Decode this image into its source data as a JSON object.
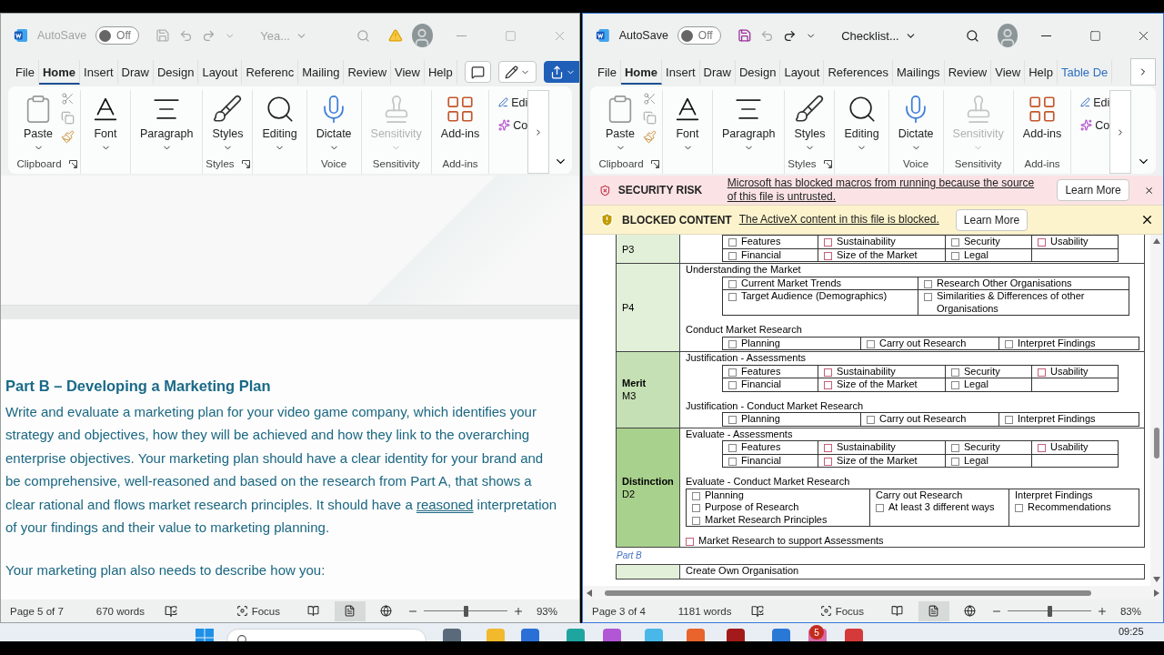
{
  "windows": [
    {
      "active": false,
      "title_bar": {
        "autosave_label": "AutoSave",
        "autosave": {
          "label": "Off",
          "on": false
        },
        "document_title": "Yea...",
        "warning": true
      },
      "tabs": [
        {
          "label": "File",
          "selected": false,
          "kind": "plain"
        },
        {
          "label": "Home",
          "selected": true,
          "kind": "plain"
        },
        {
          "label": "Insert",
          "selected": false,
          "kind": "plain"
        },
        {
          "label": "Draw",
          "selected": false,
          "kind": "plain"
        },
        {
          "label": "Design",
          "selected": false,
          "kind": "plain"
        },
        {
          "label": "Layout",
          "selected": false,
          "kind": "plain"
        },
        {
          "label": "Referenc",
          "selected": false,
          "kind": "plain"
        },
        {
          "label": "Mailing",
          "selected": false,
          "kind": "plain"
        },
        {
          "label": "Review",
          "selected": false,
          "kind": "plain"
        },
        {
          "label": "View",
          "selected": false,
          "kind": "plain"
        },
        {
          "label": "Help",
          "selected": false,
          "kind": "plain"
        }
      ],
      "tab_actions": [
        {
          "kind": "comment"
        },
        {
          "kind": "editing"
        },
        {
          "kind": "share"
        }
      ],
      "ribbon": {
        "groups": [
          {
            "label": "Clipboard",
            "launcher": true,
            "buttons": [
              {
                "kind": "paste",
                "label": "Paste",
                "disabled": false,
                "has_menu": true
              }
            ]
          },
          {
            "buttons": [
              {
                "kind": "font",
                "label": "Font",
                "disabled": false,
                "has_menu": true
              }
            ]
          },
          {
            "buttons": [
              {
                "kind": "paragraph",
                "label": "Paragraph",
                "disabled": false,
                "has_menu": true
              }
            ]
          },
          {
            "label": "Styles",
            "launcher": true,
            "buttons": [
              {
                "kind": "styles",
                "label": "Styles",
                "disabled": false,
                "has_menu": true
              }
            ]
          },
          {
            "buttons": [
              {
                "kind": "editing",
                "label": "Editing",
                "disabled": false,
                "has_menu": true
              }
            ]
          },
          {
            "label": "Voice",
            "buttons": [
              {
                "kind": "dictate",
                "label": "Dictate",
                "disabled": false,
                "has_menu": true
              }
            ]
          },
          {
            "label": "Sensitivity",
            "buttons": [
              {
                "kind": "sensitivity",
                "label": "Sensitivity",
                "disabled": true,
                "has_menu": true
              }
            ]
          },
          {
            "label": "Add-ins",
            "buttons": [
              {
                "kind": "addins",
                "label": "Add-ins",
                "disabled": false
              }
            ]
          }
        ],
        "extras": [
          {
            "kind": "edit",
            "label": "Edi"
          },
          {
            "kind": "copilot",
            "label": "Co"
          }
        ]
      },
      "document": {
        "kind": "essay",
        "heading": "Part B – Developing a Marketing Plan",
        "paragraph": {
          "before": "Write and evaluate a marketing plan for your video game company, which identifies your strategy and objectives, how they will be achieved and how they link to the overarching enterprise objectives. Your marketing plan should have a clear identity for your brand and be comprehensive, well-reasoned and based on the research from Part A, that shows a clear rational and flows market research principles. It should have a ",
          "flagged": "reasoned",
          "after": " interpretation of your findings and their value to marketing planning."
        },
        "closing": "Your marketing plan also needs to describe how you:"
      },
      "status_bar": {
        "page": "Page 5 of 7",
        "words": "670 words",
        "focus": "Focus",
        "views": [
          {
            "kind": "read",
            "selected": false
          },
          {
            "kind": "print",
            "selected": true
          },
          {
            "kind": "web",
            "selected": false
          }
        ],
        "zoom": {
          "level": 0.5,
          "reading": "93%"
        }
      }
    },
    {
      "active": true,
      "title_bar": {
        "autosave_label": "AutoSave",
        "autosave": {
          "label": "Off",
          "on": false
        },
        "document_title": "Checklist..."
      },
      "tabs": [
        {
          "label": "File",
          "selected": false,
          "kind": "plain"
        },
        {
          "label": "Home",
          "selected": true,
          "kind": "plain"
        },
        {
          "label": "Insert",
          "selected": false,
          "kind": "plain"
        },
        {
          "label": "Draw",
          "selected": false,
          "kind": "plain"
        },
        {
          "label": "Design",
          "selected": false,
          "kind": "plain"
        },
        {
          "label": "Layout",
          "selected": false,
          "kind": "plain"
        },
        {
          "label": "References",
          "selected": false,
          "kind": "plain"
        },
        {
          "label": "Mailings",
          "selected": false,
          "kind": "plain"
        },
        {
          "label": "Review",
          "selected": false,
          "kind": "plain"
        },
        {
          "label": "View",
          "selected": false,
          "kind": "plain"
        },
        {
          "label": "Help",
          "selected": false,
          "kind": "plain"
        },
        {
          "label": "Table De",
          "selected": false,
          "kind": "contextual"
        }
      ],
      "tab_scroll_button": true,
      "ribbon": {
        "groups": [
          {
            "label": "Clipboard",
            "launcher": true,
            "buttons": [
              {
                "kind": "paste",
                "label": "Paste",
                "disabled": false,
                "has_menu": true
              }
            ]
          },
          {
            "buttons": [
              {
                "kind": "font",
                "label": "Font",
                "disabled": false,
                "has_menu": true
              }
            ]
          },
          {
            "buttons": [
              {
                "kind": "paragraph",
                "label": "Paragraph",
                "disabled": false,
                "has_menu": true
              }
            ]
          },
          {
            "label": "Styles",
            "launcher": true,
            "buttons": [
              {
                "kind": "styles",
                "label": "Styles",
                "disabled": false,
                "has_menu": true
              }
            ]
          },
          {
            "buttons": [
              {
                "kind": "editing",
                "label": "Editing",
                "disabled": false,
                "has_menu": true
              }
            ]
          },
          {
            "label": "Voice",
            "buttons": [
              {
                "kind": "dictate",
                "label": "Dictate",
                "disabled": false,
                "has_menu": true
              }
            ]
          },
          {
            "label": "Sensitivity",
            "buttons": [
              {
                "kind": "sensitivity",
                "label": "Sensitivity",
                "disabled": true,
                "has_menu": true
              }
            ]
          },
          {
            "label": "Add-ins",
            "buttons": [
              {
                "kind": "addins",
                "label": "Add-ins",
                "disabled": false
              }
            ]
          }
        ],
        "extras": [
          {
            "kind": "edit",
            "label": "Edi"
          },
          {
            "kind": "copilot",
            "label": "Co"
          }
        ]
      },
      "document": {
        "kind": "checklist",
        "banners": [
          {
            "kind": "security",
            "title": "SECURITY RISK",
            "message": "Microsoft has blocked macros from running because the source of this file is untrusted.",
            "button": "Learn More"
          },
          {
            "kind": "blocked",
            "title": "BLOCKED CONTENT",
            "message": "The ActiveX content in this file is blocked.",
            "button": "Learn More"
          }
        ],
        "rows": [
          {
            "code": "P3",
            "color": "#e2f0d9",
            "blocks": [
              {
                "kind": "grid",
                "indented": true,
                "rows": [
                  [
                    {
                      "items": [
                        "Features"
                      ]
                    },
                    {
                      "items": [
                        "Sustainability"
                      ]
                    },
                    {
                      "items": [
                        "Security"
                      ]
                    },
                    {
                      "items": [
                        "Usability"
                      ]
                    }
                  ],
                  [
                    {
                      "items": [
                        "Financial"
                      ]
                    },
                    {
                      "items": [
                        "Size of the Market"
                      ]
                    },
                    {
                      "items": [
                        "Legal"
                      ]
                    },
                    {}
                  ]
                ]
              }
            ]
          },
          {
            "code": "P4",
            "color": "#e2f0d9",
            "blocks": [
              {
                "kind": "grid",
                "heading": "Understanding the Market",
                "indented": true,
                "rows": [
                  [
                    {
                      "items": [
                        "Current Market Trends"
                      ]
                    },
                    {
                      "items": [
                        "Research Other Organisations"
                      ]
                    }
                  ],
                  [
                    {
                      "items": [
                        "Target Audience (Demographics)"
                      ]
                    },
                    {
                      "items": [
                        "Similarities & Differences of other Organisations"
                      ]
                    }
                  ]
                ]
              },
              {
                "kind": "grid",
                "heading": "Conduct Market Research",
                "indented": true,
                "rows": [
                  [
                    {
                      "items": [
                        "Planning"
                      ]
                    },
                    {
                      "items": [
                        "Carry out Research"
                      ]
                    },
                    {
                      "items": [
                        "Interpret Findings"
                      ]
                    }
                  ]
                ]
              }
            ]
          },
          {
            "grade": "Merit",
            "code": "M3",
            "color": "#c5e0b4",
            "blocks": [
              {
                "kind": "grid",
                "heading": "Justification - Assessments",
                "indented": true,
                "rows": [
                  [
                    {
                      "items": [
                        "Features"
                      ]
                    },
                    {
                      "items": [
                        "Sustainability"
                      ]
                    },
                    {
                      "items": [
                        "Security"
                      ]
                    },
                    {
                      "items": [
                        "Usability"
                      ]
                    }
                  ],
                  [
                    {
                      "items": [
                        "Financial"
                      ]
                    },
                    {
                      "items": [
                        "Size of the Market"
                      ]
                    },
                    {
                      "items": [
                        "Legal"
                      ]
                    },
                    {}
                  ]
                ]
              },
              {
                "kind": "grid",
                "heading": "Justification - Conduct Market Research",
                "indented": true,
                "rows": [
                  [
                    {
                      "items": [
                        "Planning"
                      ]
                    },
                    {
                      "items": [
                        "Carry out Research"
                      ]
                    },
                    {
                      "items": [
                        "Interpret Findings"
                      ]
                    }
                  ]
                ]
              }
            ]
          },
          {
            "grade": "Distinction",
            "code": "D2",
            "color": "#a9d18e",
            "blocks": [
              {
                "kind": "grid",
                "heading": "Evaluate - Assessments",
                "indented": true,
                "rows": [
                  [
                    {
                      "items": [
                        "Features"
                      ]
                    },
                    {
                      "items": [
                        "Sustainability"
                      ]
                    },
                    {
                      "items": [
                        "Security"
                      ]
                    },
                    {
                      "items": [
                        "Usability"
                      ]
                    }
                  ],
                  [
                    {
                      "items": [
                        "Financial"
                      ]
                    },
                    {
                      "items": [
                        "Size of the Market"
                      ]
                    },
                    {
                      "items": [
                        "Legal"
                      ]
                    },
                    {}
                  ]
                ]
              },
              {
                "kind": "grid",
                "heading": "Evaluate - Conduct Market Research",
                "indented": false,
                "rows": [
                  [
                    {
                      "items": [
                        "Planning",
                        "Purpose of Research",
                        "Market Research Principles"
                      ]
                    },
                    {
                      "title": "Carry out Research",
                      "items": [
                        "At least 3 different ways"
                      ]
                    },
                    {
                      "title": "Interpret Findings",
                      "items": [
                        "Recommendations"
                      ]
                    }
                  ]
                ]
              },
              {
                "kind": "check",
                "label": "Market Research to support Assessments"
              }
            ]
          }
        ],
        "caption": "Part B",
        "next_row": {
          "heading": "Create Own Organisation",
          "color": "#e2f0d9"
        }
      },
      "status_bar": {
        "page": "Page 3 of 4",
        "words": "1181 words",
        "focus": "Focus",
        "views": [
          {
            "kind": "read",
            "selected": false
          },
          {
            "kind": "print",
            "selected": true
          },
          {
            "kind": "web",
            "selected": false
          }
        ],
        "zoom": {
          "level": 0.5,
          "reading": "83%"
        }
      }
    }
  ],
  "taskbar": {
    "clock": "09:25",
    "badge": "5"
  }
}
